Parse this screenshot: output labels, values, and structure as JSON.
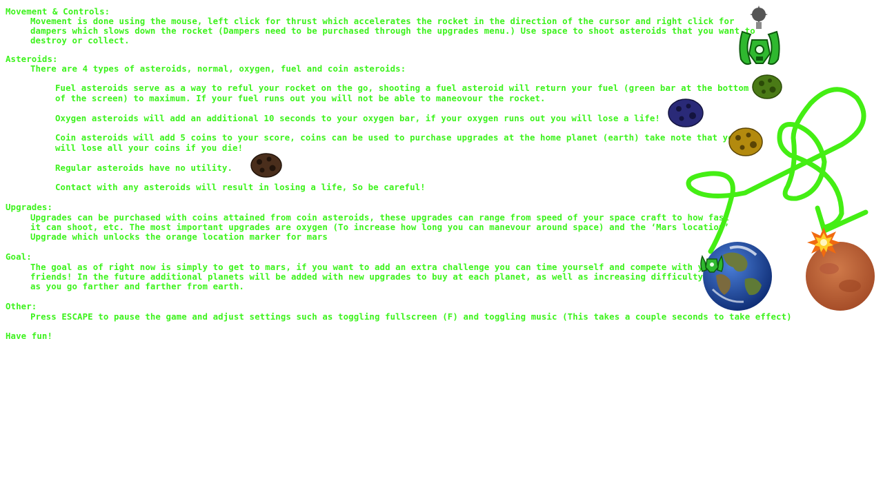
{
  "colors": {
    "text": "#3cf21c",
    "background": "#ffffff",
    "path": "#44ee14"
  },
  "sections": {
    "movement": {
      "heading": "Movement & Controls:",
      "lines": [
        "Movement is done using the mouse, left click for thrust which accelerates the rocket in the direction of the cursor and right click for",
        "dampers which slows down the rocket (Dampers need to be purchased through the upgrades menu.) Use space to shoot asteroids that you want to",
        "destroy or collect."
      ]
    },
    "asteroids": {
      "heading": "Asteroids:",
      "intro": "There are 4 types of asteroids, normal, oxygen, fuel and coin asteroids:",
      "fuel": [
        "Fuel asteroids serve as a way to reful your rocket on the go, shooting a fuel asteroid will return your fuel (green bar at the bottom",
        "of the screen) to maximum. If your fuel runs out you will not be able to maneovour the rocket."
      ],
      "oxygen": "Oxygen asteroids will add an additional 10 seconds to your oxygen bar, if your oxygen runs out you will lose a life!",
      "coin": [
        "Coin asteroids will add 5 coins to your score, coins can be used to purchase upgrades at the home planet (earth) take note that you",
        "will lose all your coins if you die!"
      ],
      "regular": "Regular asteroids have no utility.",
      "contact": "Contact with any asteroids will result in losing a life, So be careful!"
    },
    "upgrades": {
      "heading": "Upgrades:",
      "lines": [
        "Upgrades can be purchased with coins attained from coin asteroids, these upgrades can range from speed of your space craft to how fast",
        "it can shoot, etc. The most important upgrades are oxygen (To increase how long you can manevour around space) and the ‘Mars location’",
        "Upgrade which unlocks the orange location marker for mars"
      ]
    },
    "goal": {
      "heading": "Goal:",
      "lines": [
        "The goal as of right now is simply to get to mars, if you want to add an extra challenge you can time yourself and compete with your",
        "friends! In the future additional planets will be added with new upgrades to buy at each planet, as well as increasing difficulty",
        "as you go farther and farther from earth."
      ]
    },
    "other": {
      "heading": "Other:",
      "lines": [
        "Press ESCAPE to pause the game and adjust settings such as toggling fullscreen (F) and toggling music (This takes a couple seconds to take effect)"
      ]
    },
    "closing": "Have fun!"
  },
  "icons": {
    "rocket": "rocket-icon",
    "fuel_asteroid": "fuel-asteroid-icon",
    "oxygen_asteroid": "oxygen-asteroid-icon",
    "coin_asteroid": "coin-asteroid-icon",
    "regular_asteroid": "regular-asteroid-icon",
    "earth": "earth-icon",
    "mars": "mars-icon",
    "explosion": "explosion-icon"
  }
}
